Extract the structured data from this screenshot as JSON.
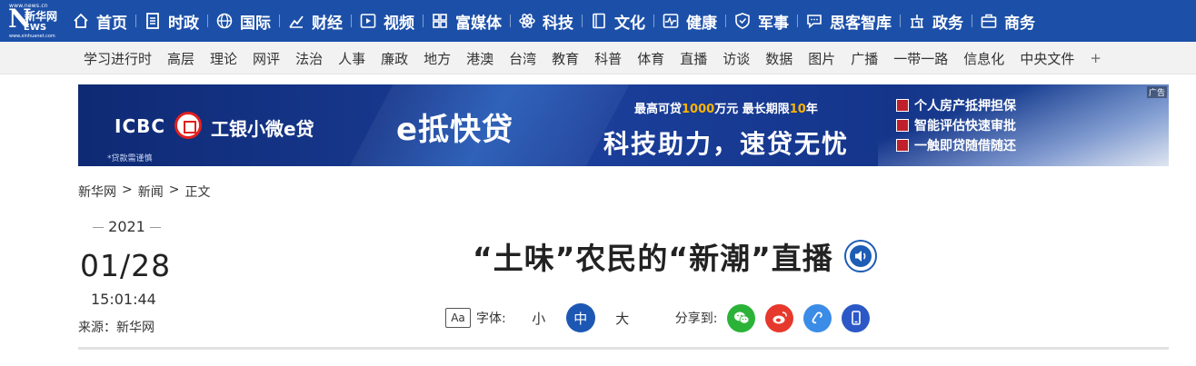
{
  "logo": {
    "url_text": "www.news.cn",
    "letter": "N",
    "name_cn": "新华网",
    "news_rest": "EWS",
    "sub_text": "www.xinhuanet.com"
  },
  "top_nav": {
    "items": [
      {
        "label": "首页",
        "icon": "home-icon"
      },
      {
        "label": "时政",
        "icon": "document-icon"
      },
      {
        "label": "国际",
        "icon": "globe-icon"
      },
      {
        "label": "财经",
        "icon": "chart-icon"
      },
      {
        "label": "视频",
        "icon": "play-icon"
      },
      {
        "label": "富媒体",
        "icon": "grid-icon"
      },
      {
        "label": "科技",
        "icon": "atom-icon"
      },
      {
        "label": "文化",
        "icon": "book-icon"
      },
      {
        "label": "健康",
        "icon": "pulse-icon"
      },
      {
        "label": "军事",
        "icon": "shield-icon"
      },
      {
        "label": "思客智库",
        "icon": "chat-icon"
      },
      {
        "label": "政务",
        "icon": "building-icon"
      },
      {
        "label": "商务",
        "icon": "briefcase-icon"
      }
    ]
  },
  "sub_nav": {
    "items": [
      "学习进行时",
      "高层",
      "理论",
      "网评",
      "法治",
      "人事",
      "廉政",
      "地方",
      "港澳",
      "台湾",
      "教育",
      "科普",
      "体育",
      "直播",
      "访谈",
      "数据",
      "图片",
      "广播",
      "一带一路",
      "信息化",
      "中央文件"
    ],
    "more": "+"
  },
  "banner": {
    "icbc": "ICBC",
    "brand": "工银小微e贷",
    "tagline": "*贷款需谨慎",
    "product": "e抵快贷",
    "line1_a": "最高可贷",
    "line1_amount": "1000",
    "line1_b": "万元  最长期限",
    "line1_term": "10",
    "line1_c": "年",
    "line2": "科技助力，速贷无忧",
    "features": [
      "个人房产抵押担保",
      "智能评估快速审批",
      "一触即贷随借随还"
    ],
    "ad_label": "广告"
  },
  "breadcrumb": {
    "items": [
      "新华网",
      "新闻",
      "正文"
    ],
    "separator": ">"
  },
  "article": {
    "year": "2021",
    "date": "01/28",
    "time": "15:01:44",
    "source": "来源：新华网",
    "title": "“土味”农民的“新潮”直播"
  },
  "toolbar": {
    "font_icon_text": "Aa",
    "font_label": "字体:",
    "size_small": "小",
    "size_medium": "中",
    "size_large": "大",
    "share_label": "分享到:"
  },
  "colors": {
    "nav_blue": "#1c50a8",
    "accent_blue": "#1c58b3",
    "wechat_green": "#2bb339",
    "weibo_red": "#e6382c",
    "link_blue": "#3b8ce6",
    "mobile_blue": "#2c58c7"
  }
}
